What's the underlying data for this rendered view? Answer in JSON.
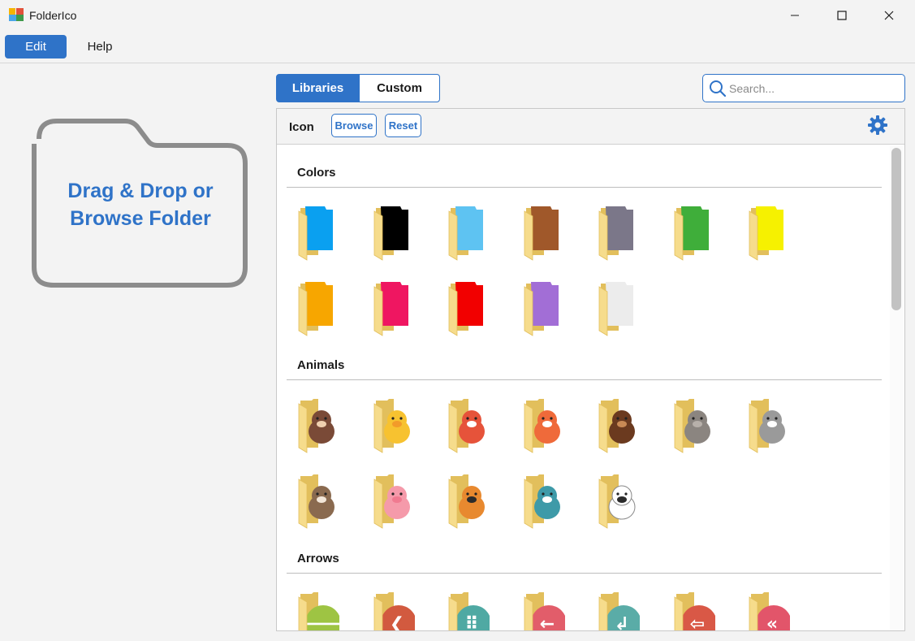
{
  "window": {
    "title": "FolderIco"
  },
  "menu": {
    "edit_label": "Edit",
    "help_label": "Help"
  },
  "dropzone": {
    "line1": "Drag & Drop or",
    "line2": "Browse Folder"
  },
  "tabs": {
    "libraries_label": "Libraries",
    "custom_label": "Custom",
    "active": "Libraries"
  },
  "search": {
    "placeholder": "Search...",
    "value": ""
  },
  "toolbar": {
    "icon_label": "Icon",
    "browse_label": "Browse",
    "reset_label": "Reset"
  },
  "colors": {
    "accent": "#2f73c8",
    "folder_body": "#f6dc8c",
    "folder_edge": "#e2bf5c"
  },
  "sections": [
    {
      "title": "Colors",
      "items": [
        {
          "name": "blue",
          "kind": "color",
          "color": "#0aa0f0"
        },
        {
          "name": "black",
          "kind": "color",
          "color": "#000000"
        },
        {
          "name": "light-blue",
          "kind": "color",
          "color": "#5ec3f2"
        },
        {
          "name": "brown",
          "kind": "color",
          "color": "#a0582a"
        },
        {
          "name": "gray",
          "kind": "color",
          "color": "#7b7789"
        },
        {
          "name": "green",
          "kind": "color",
          "color": "#3fae3a"
        },
        {
          "name": "yellow",
          "kind": "color",
          "color": "#f6f100"
        },
        {
          "name": "orange",
          "kind": "color",
          "color": "#f7a600"
        },
        {
          "name": "pink",
          "kind": "color",
          "color": "#ef1661"
        },
        {
          "name": "red",
          "kind": "color",
          "color": "#f20000"
        },
        {
          "name": "purple",
          "kind": "color",
          "color": "#a26ed6"
        },
        {
          "name": "white",
          "kind": "color",
          "color": "#ececec"
        }
      ]
    },
    {
      "title": "Animals",
      "items": [
        {
          "name": "buffalo",
          "kind": "animal",
          "color": "#7a4a37",
          "accent": "#f0d0b0"
        },
        {
          "name": "chick",
          "kind": "animal",
          "color": "#f7c230",
          "accent": "#f29b2a"
        },
        {
          "name": "crab",
          "kind": "animal",
          "color": "#e6533a",
          "accent": "#ffffff"
        },
        {
          "name": "fox",
          "kind": "animal",
          "color": "#ef6a3a",
          "accent": "#ffffff"
        },
        {
          "name": "hedgehog",
          "kind": "animal",
          "color": "#6b3a1f",
          "accent": "#c98a55"
        },
        {
          "name": "hippo",
          "kind": "animal",
          "color": "#8b8580",
          "accent": "#b7b0aa"
        },
        {
          "name": "koala",
          "kind": "animal",
          "color": "#9a9a9a",
          "accent": "#ffffff"
        },
        {
          "name": "raccoon",
          "kind": "animal",
          "color": "#8a6a4f",
          "accent": "#f2e6d8"
        },
        {
          "name": "pig",
          "kind": "animal",
          "color": "#f59aaa",
          "accent": "#f07a90"
        },
        {
          "name": "tiger",
          "kind": "animal",
          "color": "#e8892f",
          "accent": "#2b2b2b"
        },
        {
          "name": "whale",
          "kind": "animal",
          "color": "#3e9aa8",
          "accent": "#ffffff"
        },
        {
          "name": "zebra",
          "kind": "animal",
          "color": "#ffffff",
          "accent": "#2b2b2b"
        }
      ]
    },
    {
      "title": "Arrows",
      "items": [
        {
          "name": "arrow-left-green",
          "kind": "arrow",
          "color": "#9ec443",
          "glyph": "🡐"
        },
        {
          "name": "arrow-left-red",
          "kind": "arrow",
          "color": "#d25a3f",
          "glyph": "❮"
        },
        {
          "name": "arrow-dotted-teal",
          "kind": "arrow",
          "color": "#4fa9a3",
          "glyph": "⠿"
        },
        {
          "name": "arrow-left-pink",
          "kind": "arrow",
          "color": "#e25d6a",
          "glyph": "←"
        },
        {
          "name": "arrow-curve-teal",
          "kind": "arrow",
          "color": "#5aaca7",
          "glyph": "↲"
        },
        {
          "name": "arrow-left-red2",
          "kind": "arrow",
          "color": "#d95846",
          "glyph": "⇦"
        },
        {
          "name": "arrow-double-pink",
          "kind": "arrow",
          "color": "#e2556a",
          "glyph": "«"
        }
      ]
    }
  ]
}
